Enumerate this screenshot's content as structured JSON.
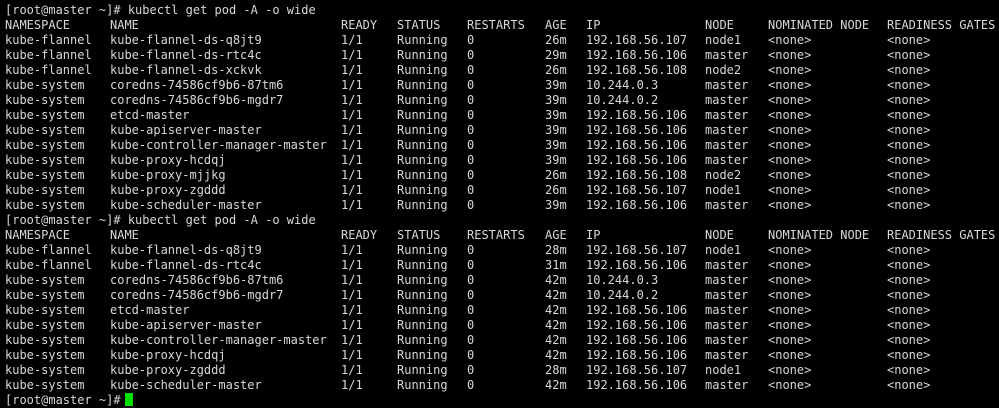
{
  "terminal": {
    "prompt": "[root@master ~]#",
    "cursor_color": "#00e000",
    "blocks": [
      {
        "command": "kubectl get pod -A -o wide",
        "header": {
          "namespace": "NAMESPACE",
          "name": "NAME",
          "ready": "READY",
          "status": "STATUS",
          "restarts": "RESTARTS",
          "age": "AGE",
          "ip": "IP",
          "node": "NODE",
          "nominated_node": "NOMINATED NODE",
          "readiness_gates": "READINESS GATES"
        },
        "rows": [
          {
            "namespace": "kube-flannel",
            "name": "kube-flannel-ds-q8jt9",
            "ready": "1/1",
            "status": "Running",
            "restarts": "0",
            "age": "26m",
            "ip": "192.168.56.107",
            "node": "node1",
            "nominated_node": "<none>",
            "readiness_gates": "<none>"
          },
          {
            "namespace": "kube-flannel",
            "name": "kube-flannel-ds-rtc4c",
            "ready": "1/1",
            "status": "Running",
            "restarts": "0",
            "age": "29m",
            "ip": "192.168.56.106",
            "node": "master",
            "nominated_node": "<none>",
            "readiness_gates": "<none>"
          },
          {
            "namespace": "kube-flannel",
            "name": "kube-flannel-ds-xckvk",
            "ready": "1/1",
            "status": "Running",
            "restarts": "0",
            "age": "26m",
            "ip": "192.168.56.108",
            "node": "node2",
            "nominated_node": "<none>",
            "readiness_gates": "<none>"
          },
          {
            "namespace": "kube-system",
            "name": "coredns-74586cf9b6-87tm6",
            "ready": "1/1",
            "status": "Running",
            "restarts": "0",
            "age": "39m",
            "ip": "10.244.0.3",
            "node": "master",
            "nominated_node": "<none>",
            "readiness_gates": "<none>"
          },
          {
            "namespace": "kube-system",
            "name": "coredns-74586cf9b6-mgdr7",
            "ready": "1/1",
            "status": "Running",
            "restarts": "0",
            "age": "39m",
            "ip": "10.244.0.2",
            "node": "master",
            "nominated_node": "<none>",
            "readiness_gates": "<none>"
          },
          {
            "namespace": "kube-system",
            "name": "etcd-master",
            "ready": "1/1",
            "status": "Running",
            "restarts": "0",
            "age": "39m",
            "ip": "192.168.56.106",
            "node": "master",
            "nominated_node": "<none>",
            "readiness_gates": "<none>"
          },
          {
            "namespace": "kube-system",
            "name": "kube-apiserver-master",
            "ready": "1/1",
            "status": "Running",
            "restarts": "0",
            "age": "39m",
            "ip": "192.168.56.106",
            "node": "master",
            "nominated_node": "<none>",
            "readiness_gates": "<none>"
          },
          {
            "namespace": "kube-system",
            "name": "kube-controller-manager-master",
            "ready": "1/1",
            "status": "Running",
            "restarts": "0",
            "age": "39m",
            "ip": "192.168.56.106",
            "node": "master",
            "nominated_node": "<none>",
            "readiness_gates": "<none>"
          },
          {
            "namespace": "kube-system",
            "name": "kube-proxy-hcdqj",
            "ready": "1/1",
            "status": "Running",
            "restarts": "0",
            "age": "39m",
            "ip": "192.168.56.106",
            "node": "master",
            "nominated_node": "<none>",
            "readiness_gates": "<none>"
          },
          {
            "namespace": "kube-system",
            "name": "kube-proxy-mjjkg",
            "ready": "1/1",
            "status": "Running",
            "restarts": "0",
            "age": "26m",
            "ip": "192.168.56.108",
            "node": "node2",
            "nominated_node": "<none>",
            "readiness_gates": "<none>"
          },
          {
            "namespace": "kube-system",
            "name": "kube-proxy-zgddd",
            "ready": "1/1",
            "status": "Running",
            "restarts": "0",
            "age": "26m",
            "ip": "192.168.56.107",
            "node": "node1",
            "nominated_node": "<none>",
            "readiness_gates": "<none>"
          },
          {
            "namespace": "kube-system",
            "name": "kube-scheduler-master",
            "ready": "1/1",
            "status": "Running",
            "restarts": "0",
            "age": "39m",
            "ip": "192.168.56.106",
            "node": "master",
            "nominated_node": "<none>",
            "readiness_gates": "<none>"
          }
        ]
      },
      {
        "command": "kubectl get pod -A -o wide",
        "header": {
          "namespace": "NAMESPACE",
          "name": "NAME",
          "ready": "READY",
          "status": "STATUS",
          "restarts": "RESTARTS",
          "age": "AGE",
          "ip": "IP",
          "node": "NODE",
          "nominated_node": "NOMINATED NODE",
          "readiness_gates": "READINESS GATES"
        },
        "rows": [
          {
            "namespace": "kube-flannel",
            "name": "kube-flannel-ds-q8jt9",
            "ready": "1/1",
            "status": "Running",
            "restarts": "0",
            "age": "28m",
            "ip": "192.168.56.107",
            "node": "node1",
            "nominated_node": "<none>",
            "readiness_gates": "<none>"
          },
          {
            "namespace": "kube-flannel",
            "name": "kube-flannel-ds-rtc4c",
            "ready": "1/1",
            "status": "Running",
            "restarts": "0",
            "age": "31m",
            "ip": "192.168.56.106",
            "node": "master",
            "nominated_node": "<none>",
            "readiness_gates": "<none>"
          },
          {
            "namespace": "kube-system",
            "name": "coredns-74586cf9b6-87tm6",
            "ready": "1/1",
            "status": "Running",
            "restarts": "0",
            "age": "42m",
            "ip": "10.244.0.3",
            "node": "master",
            "nominated_node": "<none>",
            "readiness_gates": "<none>"
          },
          {
            "namespace": "kube-system",
            "name": "coredns-74586cf9b6-mgdr7",
            "ready": "1/1",
            "status": "Running",
            "restarts": "0",
            "age": "42m",
            "ip": "10.244.0.2",
            "node": "master",
            "nominated_node": "<none>",
            "readiness_gates": "<none>"
          },
          {
            "namespace": "kube-system",
            "name": "etcd-master",
            "ready": "1/1",
            "status": "Running",
            "restarts": "0",
            "age": "42m",
            "ip": "192.168.56.106",
            "node": "master",
            "nominated_node": "<none>",
            "readiness_gates": "<none>"
          },
          {
            "namespace": "kube-system",
            "name": "kube-apiserver-master",
            "ready": "1/1",
            "status": "Running",
            "restarts": "0",
            "age": "42m",
            "ip": "192.168.56.106",
            "node": "master",
            "nominated_node": "<none>",
            "readiness_gates": "<none>"
          },
          {
            "namespace": "kube-system",
            "name": "kube-controller-manager-master",
            "ready": "1/1",
            "status": "Running",
            "restarts": "0",
            "age": "42m",
            "ip": "192.168.56.106",
            "node": "master",
            "nominated_node": "<none>",
            "readiness_gates": "<none>"
          },
          {
            "namespace": "kube-system",
            "name": "kube-proxy-hcdqj",
            "ready": "1/1",
            "status": "Running",
            "restarts": "0",
            "age": "42m",
            "ip": "192.168.56.106",
            "node": "master",
            "nominated_node": "<none>",
            "readiness_gates": "<none>"
          },
          {
            "namespace": "kube-system",
            "name": "kube-proxy-zgddd",
            "ready": "1/1",
            "status": "Running",
            "restarts": "0",
            "age": "28m",
            "ip": "192.168.56.107",
            "node": "node1",
            "nominated_node": "<none>",
            "readiness_gates": "<none>"
          },
          {
            "namespace": "kube-system",
            "name": "kube-scheduler-master",
            "ready": "1/1",
            "status": "Running",
            "restarts": "0",
            "age": "42m",
            "ip": "192.168.56.106",
            "node": "master",
            "nominated_node": "<none>",
            "readiness_gates": "<none>"
          }
        ]
      }
    ]
  }
}
